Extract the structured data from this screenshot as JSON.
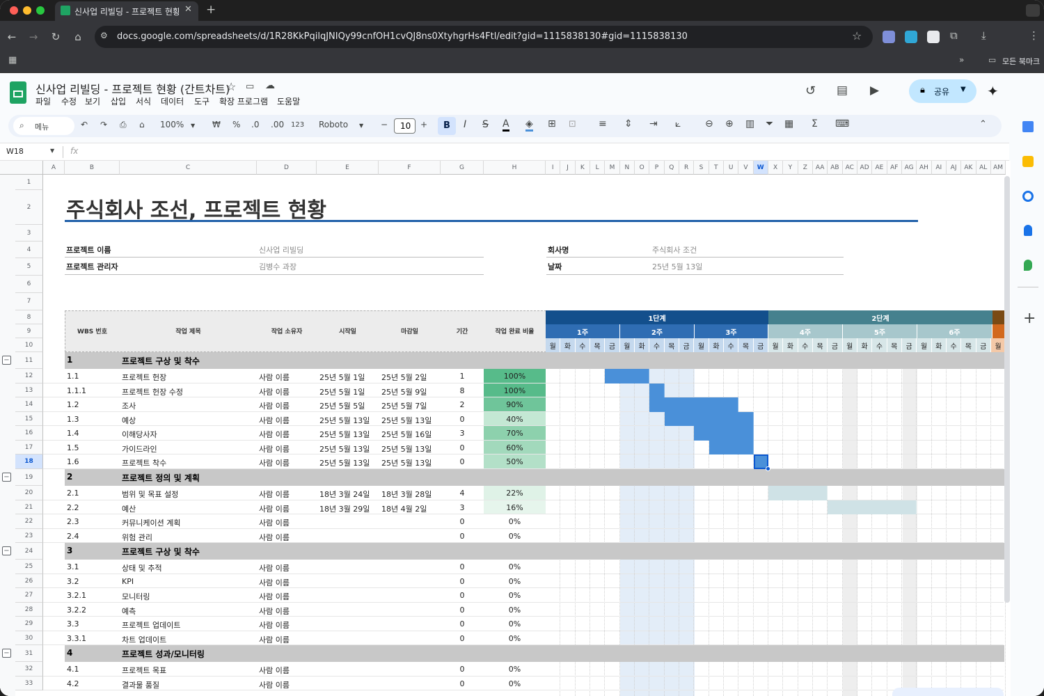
{
  "browser": {
    "tab_title": "신사업 리빌딩 - 프로젝트 현황 (간트",
    "url": "docs.google.com/spreadsheets/d/1R28KkPqilqJNIQy99cnfOH1cvQJ8ns0XtyhgrHs4Ftl/edit?gid=1115838130#gid=1115838130",
    "bookmarks_label": "모든 북마크",
    "bookmarks_more": "»"
  },
  "doc": {
    "title": "신사업 리빌딩 - 프로젝트 현황 (간트차트)",
    "menus": [
      "파일",
      "수정",
      "보기",
      "삽입",
      "서식",
      "데이터",
      "도구",
      "확장 프로그램",
      "도움말"
    ],
    "share_label": "공유"
  },
  "toolbar": {
    "search_label": "메뉴",
    "zoom": "100%",
    "currency": "₩",
    "percent": "%",
    "dec_dec": ".0",
    "dec_inc": ".00",
    "format_123": "123",
    "font": "Roboto",
    "font_size": "10",
    "bold": "B",
    "italic": "I",
    "strike": "S",
    "text_color": "A",
    "sum": "Σ"
  },
  "formula": {
    "cell_ref": "W18",
    "fx": "fx",
    "value": ""
  },
  "columns": [
    "A",
    "B",
    "C",
    "D",
    "E",
    "F",
    "G",
    "H",
    "I",
    "J",
    "K",
    "L",
    "M",
    "N",
    "O",
    "P",
    "Q",
    "R",
    "S",
    "T",
    "U",
    "V",
    "W",
    "X",
    "Y",
    "Z",
    "AA",
    "AB",
    "AC",
    "AD",
    "AE",
    "AF",
    "AG",
    "AH",
    "AI",
    "AJ",
    "AK",
    "AL",
    "AM"
  ],
  "rows": [
    "1",
    "2",
    "3",
    "4",
    "5",
    "6",
    "7",
    "8",
    "9",
    "10",
    "11",
    "12",
    "13",
    "14",
    "15",
    "16",
    "17",
    "18",
    "19",
    "20",
    "21",
    "22",
    "23",
    "24",
    "25",
    "26",
    "27",
    "28",
    "29",
    "30",
    "31",
    "32",
    "33"
  ],
  "sheet": {
    "title": "주식회사 조선, 프로젝트 현황",
    "info": {
      "project_name_label": "프로젝트 이름",
      "project_name": "신사업 리빌딩",
      "manager_label": "프로젝트 관리자",
      "manager": "김병수 과장",
      "company_label": "회사명",
      "company": "주식회사 조건",
      "date_label": "날짜",
      "date": "25년 5월 13일"
    },
    "headers": {
      "wbs": "WBS 번호",
      "task": "작업 제목",
      "owner": "작업 소유자",
      "start": "시작일",
      "due": "마감일",
      "duration": "기간",
      "pct": "작업 완료 비율"
    },
    "phases": [
      "1단계",
      "2단계"
    ],
    "weeks": [
      "1주",
      "2주",
      "3주",
      "4주",
      "5주",
      "6주"
    ],
    "days": [
      "월",
      "화",
      "수",
      "목",
      "금",
      "월",
      "화",
      "수",
      "목",
      "금",
      "월",
      "화",
      "수",
      "목",
      "금",
      "월",
      "화",
      "수",
      "목",
      "금",
      "월",
      "화",
      "수",
      "목",
      "금",
      "월",
      "화",
      "수",
      "목",
      "금",
      "월"
    ],
    "sections": [
      {
        "num": "1",
        "title": "프로젝트 구상 및 착수",
        "tasks": [
          {
            "wbs": "1.1",
            "task": "프로젝트 헌장",
            "owner": "사람 이름",
            "start": "25년 5월 1일",
            "due": "25년 5월 2일",
            "dur": "1",
            "pct": "100%"
          },
          {
            "wbs": "1.1.1",
            "task": "프로젝트 헌장 수정",
            "owner": "사람 이름",
            "start": "25년 5월 1일",
            "due": "25년 5월 9일",
            "dur": "8",
            "pct": "100%"
          },
          {
            "wbs": "1.2",
            "task": "조사",
            "owner": "사람 이름",
            "start": "25년 5월 5일",
            "due": "25년 5월 7일",
            "dur": "2",
            "pct": "90%"
          },
          {
            "wbs": "1.3",
            "task": "예상",
            "owner": "사람 이름",
            "start": "25년 5월 13일",
            "due": "25년 5월 13일",
            "dur": "0",
            "pct": "40%"
          },
          {
            "wbs": "1.4",
            "task": "이해당사자",
            "owner": "사람 이름",
            "start": "25년 5월 13일",
            "due": "25년 5월 16일",
            "dur": "3",
            "pct": "70%"
          },
          {
            "wbs": "1.5",
            "task": "가이드라인",
            "owner": "사람 이름",
            "start": "25년 5월 13일",
            "due": "25년 5월 13일",
            "dur": "0",
            "pct": "60%"
          },
          {
            "wbs": "1.6",
            "task": "프로젝트 착수",
            "owner": "사람 이름",
            "start": "25년 5월 13일",
            "due": "25년 5월 13일",
            "dur": "0",
            "pct": "50%"
          }
        ]
      },
      {
        "num": "2",
        "title": "프로젝트 정의 및 계획",
        "tasks": [
          {
            "wbs": "2.1",
            "task": "범위 및 목표 설정",
            "owner": "사람 이름",
            "start": "18년 3월 24일",
            "due": "18년 3월 28일",
            "dur": "4",
            "pct": "22%"
          },
          {
            "wbs": "2.2",
            "task": "예산",
            "owner": "사람 이름",
            "start": "18년 3월 29일",
            "due": "18년 4월 2일",
            "dur": "3",
            "pct": "16%"
          },
          {
            "wbs": "2.3",
            "task": "커뮤니케이션 계획",
            "owner": "사람 이름",
            "start": "",
            "due": "",
            "dur": "0",
            "pct": "0%"
          },
          {
            "wbs": "2.4",
            "task": "위험 관리",
            "owner": "사람 이름",
            "start": "",
            "due": "",
            "dur": "0",
            "pct": "0%"
          }
        ]
      },
      {
        "num": "3",
        "title": "프로젝트 구상 및 착수",
        "tasks": [
          {
            "wbs": "3.1",
            "task": "상태 및 추적",
            "owner": "사람 이름",
            "start": "",
            "due": "",
            "dur": "0",
            "pct": "0%"
          },
          {
            "wbs": "3.2",
            "task": "KPI",
            "owner": "사람 이름",
            "start": "",
            "due": "",
            "dur": "0",
            "pct": "0%"
          },
          {
            "wbs": "3.2.1",
            "task": "모니터링",
            "owner": "사람 이름",
            "start": "",
            "due": "",
            "dur": "0",
            "pct": "0%"
          },
          {
            "wbs": "3.2.2",
            "task": "예측",
            "owner": "사람 이름",
            "start": "",
            "due": "",
            "dur": "0",
            "pct": "0%"
          },
          {
            "wbs": "3.3",
            "task": "프로젝트 업데이트",
            "owner": "사람 이름",
            "start": "",
            "due": "",
            "dur": "0",
            "pct": "0%"
          },
          {
            "wbs": "3.3.1",
            "task": "차트 업데이트",
            "owner": "사람 이름",
            "start": "",
            "due": "",
            "dur": "0",
            "pct": "0%"
          }
        ]
      },
      {
        "num": "4",
        "title": "프로젝트 성과/모니터링",
        "tasks": [
          {
            "wbs": "4.1",
            "task": "프로젝트 목표",
            "owner": "사람 이름",
            "start": "",
            "due": "",
            "dur": "0",
            "pct": "0%"
          },
          {
            "wbs": "4.2",
            "task": "결과물 품질",
            "owner": "사람 이름",
            "start": "",
            "due": "",
            "dur": "0",
            "pct": "0%"
          }
        ]
      }
    ]
  },
  "colors": {
    "accent_blue": "#0b57d0",
    "phase1": "#134f8c",
    "phase2": "#45818e",
    "gantt_bar": "#4a90d9",
    "gantt_bar2": "#cfe2e6",
    "pct_high": "#57bb8a",
    "section": "#c8c8c8"
  }
}
